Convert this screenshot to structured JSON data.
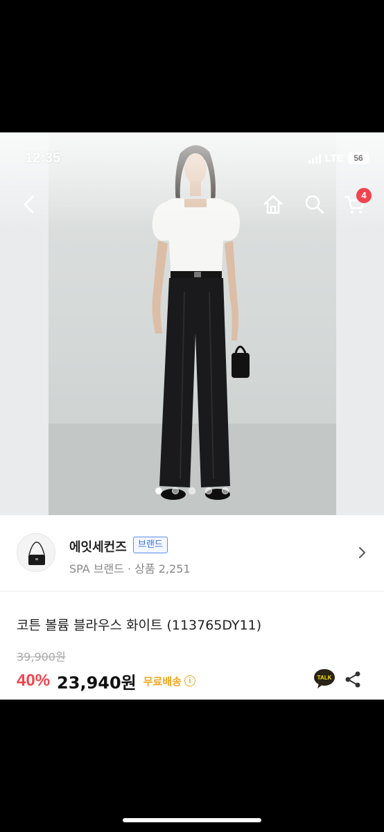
{
  "status_bar": {
    "time": "12:35",
    "network": "LTE",
    "battery": "56"
  },
  "nav": {
    "cart_count": "4"
  },
  "gallery": {
    "slide_count": 5,
    "active_index": 0
  },
  "seller": {
    "name": "에잇세컨즈",
    "badge": "브랜드",
    "meta": "SPA 브랜드 · 상품 2,251"
  },
  "product": {
    "title": "코튼 볼륨 블라우스  화이트 (113765DY11)",
    "original_price": "39,900원",
    "discount": "40%",
    "price": "23,940원",
    "shipping": "무료배송",
    "talk_label": "TALK"
  },
  "colors": {
    "accent_red": "#f0444f",
    "shipping_orange": "#f0a71f",
    "brand_blue": "#3a70e0"
  }
}
